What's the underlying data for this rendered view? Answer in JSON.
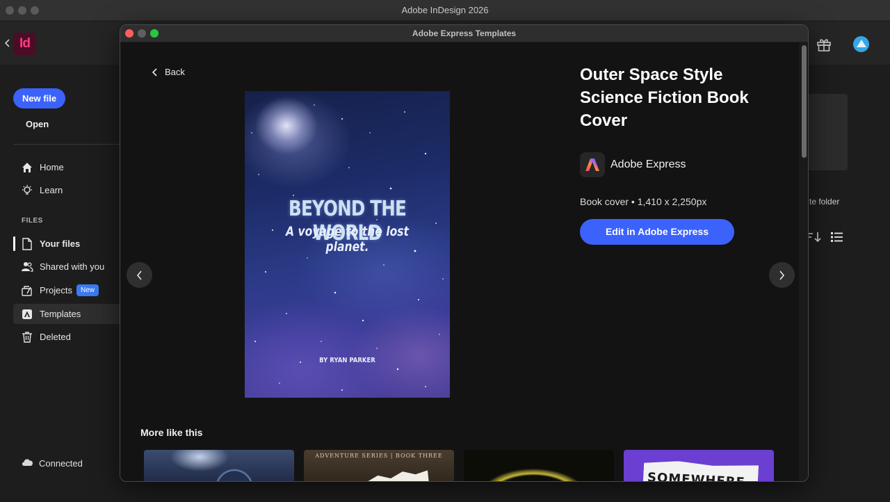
{
  "app": {
    "window_title": "Adobe InDesign 2026",
    "logo_text": "Id"
  },
  "sidebar": {
    "new_file_label": "New file",
    "open_label": "Open",
    "nav": [
      {
        "label": "Home",
        "icon": "home-icon"
      },
      {
        "label": "Learn",
        "icon": "lightbulb-icon"
      }
    ],
    "files_header": "FILES",
    "files": [
      {
        "label": "Your files",
        "icon": "file-icon"
      },
      {
        "label": "Shared with you",
        "icon": "users-icon"
      },
      {
        "label": "Projects",
        "icon": "projects-icon",
        "badge": "New"
      },
      {
        "label": "Templates",
        "icon": "templates-icon"
      },
      {
        "label": "Deleted",
        "icon": "trash-icon"
      }
    ],
    "connection_status": "Connected"
  },
  "background": {
    "folder_text": "te folder"
  },
  "modal": {
    "title": "Adobe Express Templates",
    "back_label": "Back",
    "template": {
      "title": "Outer Space Style Science Fiction Book Cover",
      "brand_name": "Adobe Express",
      "meta": "Book cover • 1,410 x 2,250px",
      "edit_label": "Edit in Adobe Express",
      "cover": {
        "title": "BEYOND THE WORLD",
        "subtitle": "A voyage to the lost planet.",
        "author": "BY RYAN PARKER"
      }
    },
    "more_like_this_label": "More like this",
    "thumbnails": [
      {
        "text": ""
      },
      {
        "text": "ADVENTURE SERIES | BOOK THREE"
      },
      {
        "text": ""
      },
      {
        "text": "SOMEWHERE"
      }
    ]
  },
  "colors": {
    "accent": "#3b63fb",
    "badge": "#3b7bf0",
    "modal_bg": "#131313",
    "app_bg": "#1d1d1d"
  }
}
